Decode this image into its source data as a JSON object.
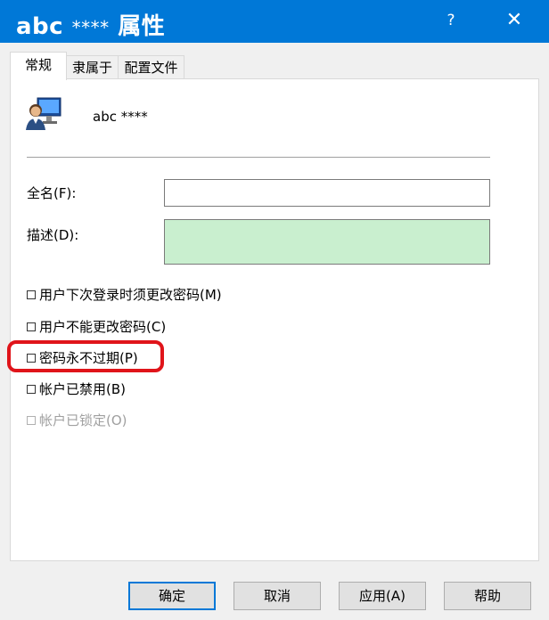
{
  "window": {
    "title_main": "abc",
    "title_mask": "****",
    "title_suffix": "属性",
    "help_label": "?",
    "close_label": "✕"
  },
  "tabs": [
    {
      "label": "常规",
      "active": true
    },
    {
      "label": "隶属于",
      "active": false
    },
    {
      "label": "配置文件",
      "active": false
    }
  ],
  "user": {
    "name": "abc ****",
    "icon": "user-computer-icon"
  },
  "form": {
    "fullname_label": "全名(F):",
    "fullname_value": "",
    "description_label": "描述(D):",
    "description_value": "",
    "description_bg": "#c9efcf"
  },
  "options": [
    {
      "label": "用户下次登录时须更改密码(M)",
      "checked": false,
      "enabled": true
    },
    {
      "label": "用户不能更改密码(C)",
      "checked": false,
      "enabled": true
    },
    {
      "label": "密码永不过期(P)",
      "checked": false,
      "enabled": true
    },
    {
      "label": "帐户已禁用(B)",
      "checked": false,
      "enabled": true
    },
    {
      "label": "帐户已锁定(O)",
      "checked": false,
      "enabled": false
    }
  ],
  "buttons": {
    "ok": "确定",
    "cancel": "取消",
    "apply": "应用(A)",
    "help": "帮助"
  },
  "colors": {
    "titlebar": "#0078d7",
    "highlight": "#e0141a"
  }
}
